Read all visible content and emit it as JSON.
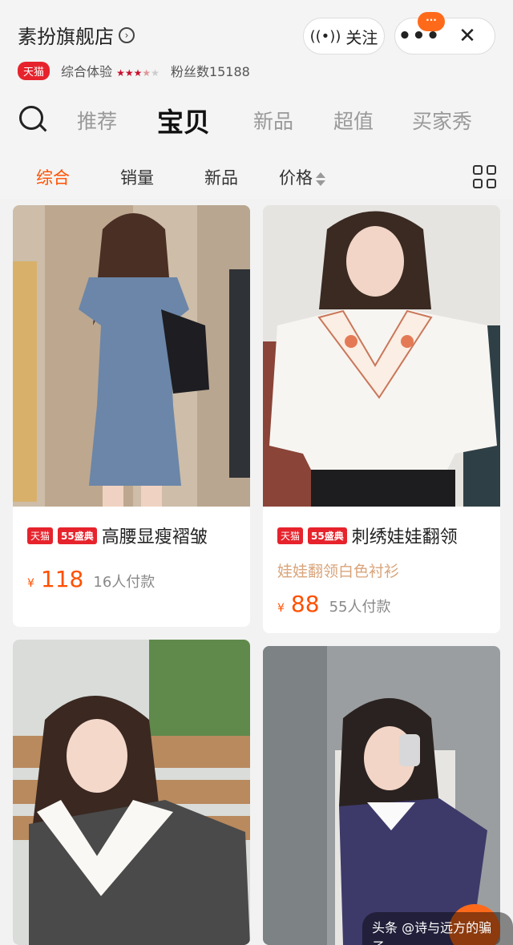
{
  "store": {
    "name": "素扮旗舰店",
    "tmall_tag": "天猫",
    "experience_label": "综合体验",
    "fans_label": "粉丝数15188"
  },
  "header_actions": {
    "follow_label": "关注",
    "badge_text": "···",
    "more_label": "•••",
    "close_label": "✕"
  },
  "nav_tabs": [
    "推荐",
    "宝贝",
    "新品",
    "超值",
    "买家秀"
  ],
  "active_nav_tab": "宝贝",
  "sort_options": [
    "综合",
    "销量",
    "新品",
    "价格"
  ],
  "active_sort": "综合",
  "products": [
    {
      "tag_tmall": "天猫",
      "tag_event": "55盛典",
      "title": "高腰显瘦褶皱",
      "subtitle": "",
      "currency": "¥",
      "price": "118",
      "sold": "16人付款",
      "photo_colors": [
        "#c9b9a8",
        "#6b86a8"
      ]
    },
    {
      "tag_tmall": "天猫",
      "tag_event": "55盛典",
      "title": "刺绣娃娃翻领",
      "subtitle": "娃娃翻领白色衬衫",
      "currency": "¥",
      "price": "88",
      "sold": "55人付款",
      "photo_colors": [
        "#e8e6e2",
        "#f4f2ee"
      ]
    },
    {
      "tag_tmall": "",
      "tag_event": "",
      "title": "",
      "subtitle": "",
      "currency": "",
      "price": "",
      "sold": "",
      "photo_colors": [
        "#b98a5e",
        "#4a4a4a"
      ]
    },
    {
      "tag_tmall": "",
      "tag_event": "",
      "title": "",
      "subtitle": "",
      "currency": "",
      "price": "",
      "sold": "",
      "photo_colors": [
        "#8a8f92",
        "#3d3a6a"
      ]
    }
  ],
  "watermark": "头条 @诗与远方的骗子",
  "colors": {
    "accent": "#ff5000",
    "tmall_red": "#e6232c",
    "badge_orange": "#ff6a1a"
  }
}
